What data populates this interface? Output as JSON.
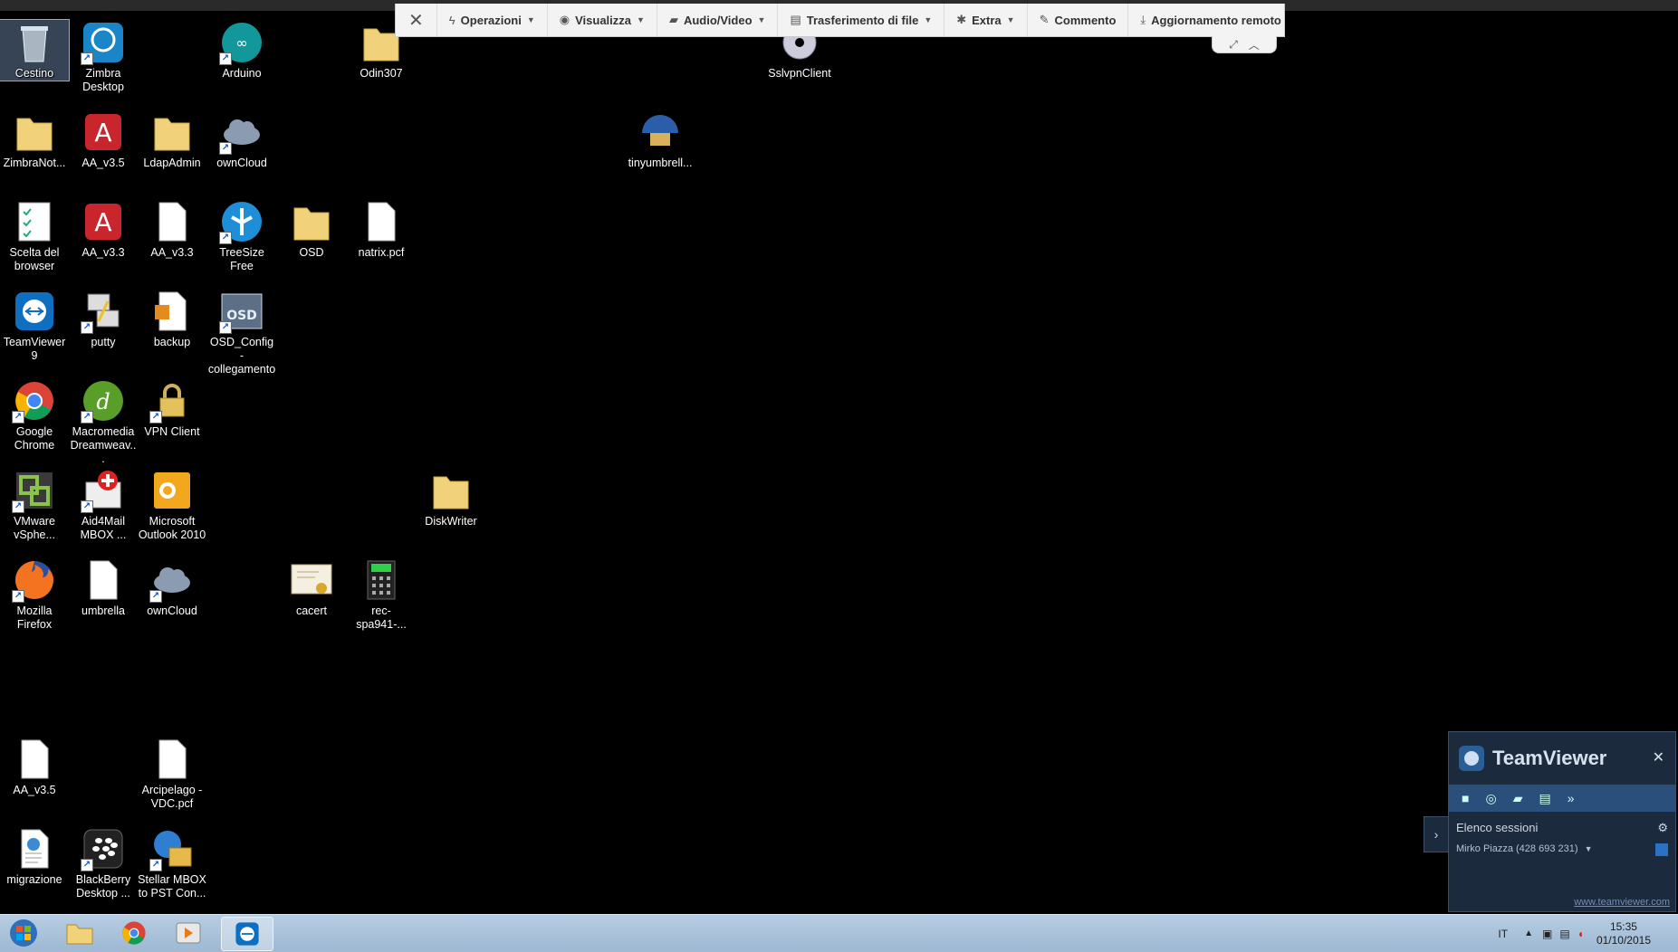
{
  "desktop": {
    "icons": {
      "cestino": "Cestino",
      "zimbra_desktop": "Zimbra Desktop",
      "arduino": "Arduino",
      "odin307": "Odin307",
      "sslvpnclient": "SslvpnClient",
      "zimbranot": "ZimbraNot...",
      "aa_v35_a": "AA_v3.5",
      "ldapadmin": "LdapAdmin",
      "owncloud_a": "ownCloud",
      "tinyumbrell": "tinyumbrell...",
      "scelta_browser": "Scelta del browser",
      "aa_v33_a": "AA_v3.3",
      "aa_v33_b": "AA_v3.3",
      "treesize": "TreeSize Free",
      "osd": "OSD",
      "natrix": "natrix.pcf",
      "teamviewer9": "TeamViewer 9",
      "putty": "putty",
      "backup": "backup",
      "osd_config": "OSD_Config - collegamento",
      "chrome": "Google Chrome",
      "dreamweaver": "Macromedia Dreamweav...",
      "vpn_client": "VPN Client",
      "vmware": "VMware vSphe...",
      "aid4mail": "Aid4Mail MBOX ...",
      "outlook": "Microsoft Outlook 2010",
      "diskwriter": "DiskWriter",
      "firefox": "Mozilla Firefox",
      "umbrella": "umbrella",
      "owncloud_b": "ownCloud",
      "cacert": "cacert",
      "rec_spa941": "rec-spa941-...",
      "aa_v35_b": "AA_v3.5",
      "arcipelago": "Arcipelago - VDC.pcf",
      "migrazione": "migrazione",
      "blackberry": "BlackBerry Desktop ...",
      "stellar": "Stellar MBOX to PST Con..."
    }
  },
  "tv_toolbar": {
    "close": "✕",
    "operazioni": "Operazioni",
    "visualizza": "Visualizza",
    "audio_video": "Audio/Video",
    "trasferimento": "Trasferimento di file",
    "extra": "Extra",
    "commento": "Commento",
    "aggiornamento": "Aggiornamento remoto"
  },
  "tv_panel": {
    "brand": "TeamViewer",
    "close": "✕",
    "sessions_title": "Elenco sessioni",
    "session_entry": "Mirko Piazza (428 693 231)",
    "link": "www.teamviewer.com"
  },
  "taskbar": {
    "language": "IT",
    "time": "15:35",
    "date": "01/10/2015"
  },
  "colors": {
    "desktop_bg": "#000000",
    "taskbar_top": "#b6cde2",
    "toolbar_bg": "#f3f3f3",
    "tv_panel_bg": "#1b2a3c"
  }
}
